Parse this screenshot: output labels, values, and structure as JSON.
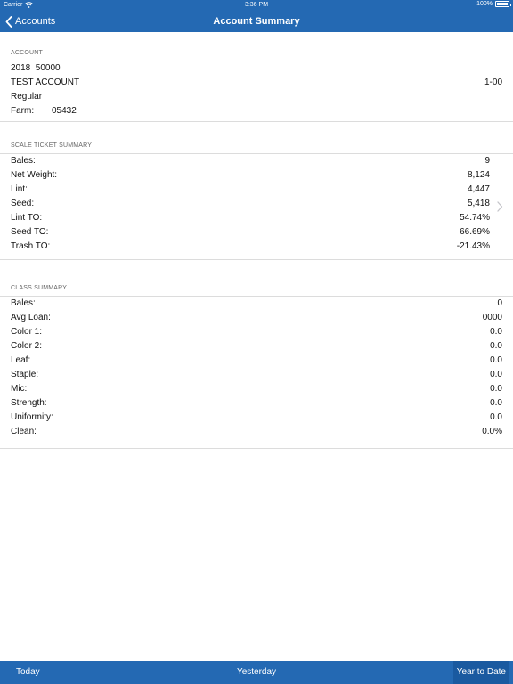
{
  "status": {
    "carrier": "Carrier",
    "time": "3:36 PM",
    "battery": "100%"
  },
  "nav": {
    "back_label": "Accounts",
    "title": "Account Summary"
  },
  "account": {
    "header": "ACCOUNT",
    "year_number": "2018  50000",
    "name": "TEST ACCOUNT",
    "code": "1-00",
    "type": "Regular",
    "farm_label": "Farm:",
    "farm_value": "05432"
  },
  "scale_ticket": {
    "header": "SCALE TICKET SUMMARY",
    "rows": [
      {
        "label": "Bales:",
        "value": "9"
      },
      {
        "label": "Net Weight:",
        "value": "8,124"
      },
      {
        "label": "Lint:",
        "value": "4,447"
      },
      {
        "label": "Seed:",
        "value": "5,418"
      },
      {
        "label": "Lint TO:",
        "value": "54.74%"
      },
      {
        "label": "Seed TO:",
        "value": "66.69%"
      },
      {
        "label": "Trash TO:",
        "value": "-21.43%"
      }
    ]
  },
  "class_summary": {
    "header": "CLASS SUMMARY",
    "rows": [
      {
        "label": "Bales:",
        "value": "0"
      },
      {
        "label": "Avg Loan:",
        "value": "0000"
      },
      {
        "label": "Color 1:",
        "value": "0.0"
      },
      {
        "label": "Color 2:",
        "value": "0.0"
      },
      {
        "label": "Leaf:",
        "value": "0.0"
      },
      {
        "label": "Staple:",
        "value": "0.0"
      },
      {
        "label": "Mic:",
        "value": "0.0"
      },
      {
        "label": "Strength:",
        "value": "0.0"
      },
      {
        "label": "Uniformity:",
        "value": "0.0"
      },
      {
        "label": "Clean:",
        "value": "0.0%"
      }
    ]
  },
  "tabs": {
    "today": "Today",
    "yesterday": "Yesterday",
    "ytd": "Year to Date"
  },
  "colors": {
    "primary": "#2469b3",
    "divider": "#dcdcdc"
  }
}
